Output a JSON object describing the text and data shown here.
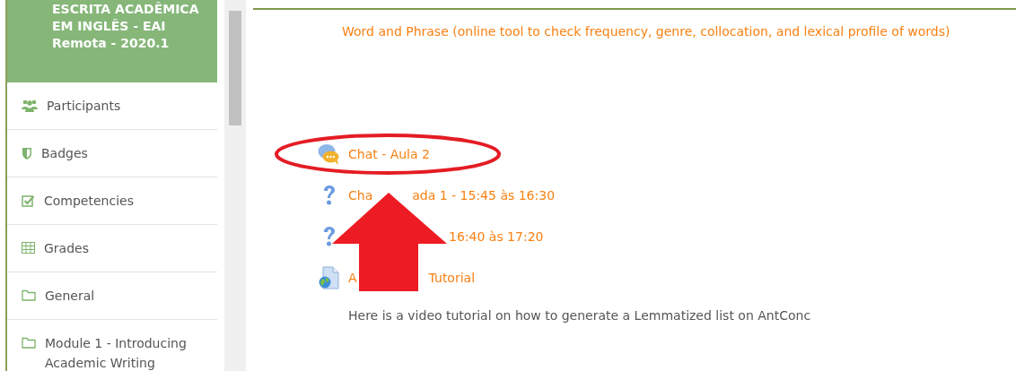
{
  "course": {
    "title_lines": [
      "ESCRITA ACADÊMICA",
      "EM INGLÊS - EAI",
      "Remota - 2020.1"
    ]
  },
  "sidebar": {
    "items": [
      {
        "label": "Participants",
        "kind": "participants"
      },
      {
        "label": "Badges",
        "kind": "badges"
      },
      {
        "label": "Competencies",
        "kind": "competencies"
      },
      {
        "label": "Grades",
        "kind": "grades"
      },
      {
        "label": "General",
        "kind": "folder"
      },
      {
        "label": "Module 1 - Introducing Academic Writing",
        "kind": "folder"
      }
    ]
  },
  "content": {
    "top_link": "Word and Phrase (online tool to check frequency, genre, collocation, and lexical profile of words)",
    "activities": [
      {
        "kind": "chat",
        "parts": [
          "Chat - Aula 2"
        ]
      },
      {
        "kind": "quiz",
        "parts": [
          "Cha",
          "ada 1 - 15:45 às 16:30"
        ]
      },
      {
        "kind": "quiz",
        "parts": [
          "16:40 às 17:20"
        ]
      },
      {
        "kind": "url",
        "parts": [
          "A",
          "Tutorial"
        ]
      }
    ],
    "description": "Here is a video tutorial on how to generate a Lemmatized list on AntConc"
  }
}
